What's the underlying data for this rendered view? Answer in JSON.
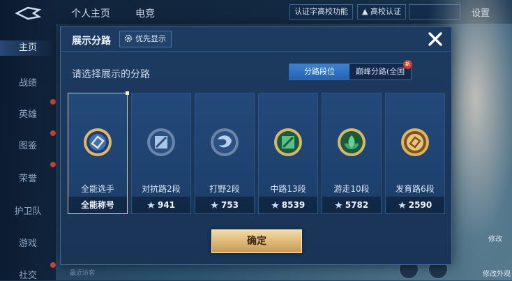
{
  "sidebar": {
    "items": [
      {
        "label": "主页"
      },
      {
        "label": "战绩"
      },
      {
        "label": "英雄"
      },
      {
        "label": "图鉴"
      },
      {
        "label": "荣誉"
      },
      {
        "label": "护卫队"
      },
      {
        "label": "游戏"
      },
      {
        "label": "社交"
      }
    ]
  },
  "topbar": {
    "tabs": [
      {
        "label": "个人主页"
      },
      {
        "label": "电竞"
      }
    ],
    "verify_label": "认证字高校功能",
    "campus_label": "高校认证",
    "settings_label": "设置"
  },
  "background": {
    "recent_visitors": "最近访客",
    "right_labels": [
      "修改",
      "修改外观"
    ]
  },
  "dialog": {
    "title": "展示分路",
    "priority_label": "优先显示",
    "subtitle": "请选择展示的分路",
    "toggle": {
      "option1": "分路段位",
      "option2": "巅峰分路(全国",
      "new_badge": "新"
    },
    "cards": [
      {
        "name": "全能选手",
        "footer": "全能称号",
        "selected": true,
        "icon": "all-round-badge-icon"
      },
      {
        "name": "对抗路2段",
        "footer": "941",
        "icon": "clash-lane-badge-icon"
      },
      {
        "name": "打野2段",
        "footer": "753",
        "icon": "jungle-badge-icon"
      },
      {
        "name": "中路13段",
        "footer": "8539",
        "icon": "mid-lane-badge-icon"
      },
      {
        "name": "游走10段",
        "footer": "5782",
        "icon": "roam-badge-icon"
      },
      {
        "name": "发育路6段",
        "footer": "2590",
        "icon": "farm-lane-badge-icon"
      }
    ],
    "confirm_label": "确定"
  },
  "colors": {
    "accent_blue": "#2f74c4",
    "gold": "#dcb776",
    "selected_border": "#d8c89a"
  }
}
